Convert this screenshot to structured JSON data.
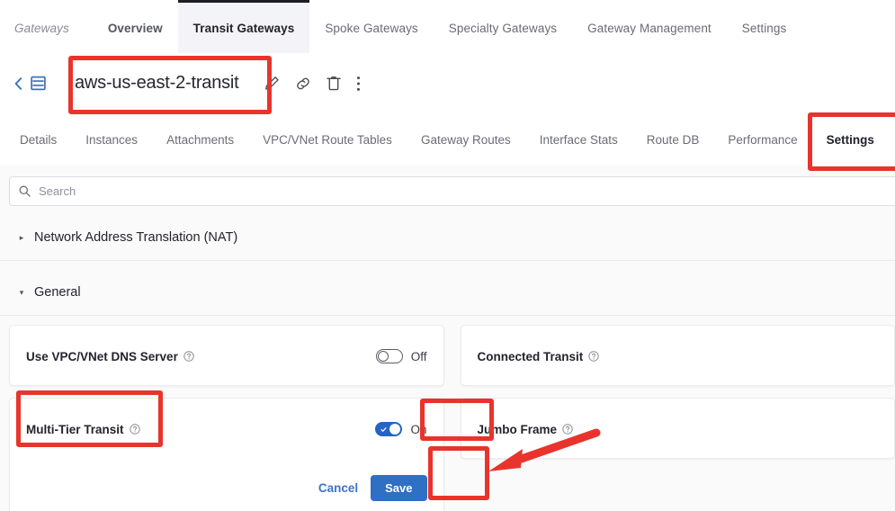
{
  "top_tabs": [
    {
      "label": "Gateways",
      "style": "crumb",
      "active": false
    },
    {
      "label": "Overview",
      "style": "strong",
      "active": false
    },
    {
      "label": "Transit Gateways",
      "style": "normal",
      "active": true
    },
    {
      "label": "Spoke Gateways",
      "style": "normal",
      "active": false
    },
    {
      "label": "Specialty Gateways",
      "style": "normal",
      "active": false
    },
    {
      "label": "Gateway Management",
      "style": "normal",
      "active": false
    },
    {
      "label": "Settings",
      "style": "normal",
      "active": false
    }
  ],
  "title_bar": {
    "gateway_name": "aws-us-east-2-transit",
    "back_icon": "chevron-left-icon",
    "list_icon": "list-view-icon",
    "actions": [
      {
        "name": "edit-icon",
        "label": "Edit"
      },
      {
        "name": "link-icon",
        "label": "Copy link"
      },
      {
        "name": "trash-icon",
        "label": "Delete"
      },
      {
        "name": "more-icon",
        "label": "More"
      }
    ]
  },
  "sub_tabs": [
    {
      "label": "Details",
      "active": false
    },
    {
      "label": "Instances",
      "active": false
    },
    {
      "label": "Attachments",
      "active": false
    },
    {
      "label": "VPC/VNet Route Tables",
      "active": false
    },
    {
      "label": "Gateway Routes",
      "active": false
    },
    {
      "label": "Interface Stats",
      "active": false
    },
    {
      "label": "Route DB",
      "active": false
    },
    {
      "label": "Performance",
      "active": false
    },
    {
      "label": "Settings",
      "active": true
    }
  ],
  "search": {
    "placeholder": "Search",
    "value": "",
    "icon": "search-icon"
  },
  "sections": [
    {
      "name": "Network Address Translation (NAT)",
      "expanded": false,
      "caret": "▸"
    },
    {
      "name": "General",
      "expanded": true,
      "caret": "▾"
    }
  ],
  "settings_cards": [
    {
      "label": "Use VPC/VNet DNS Server",
      "toggle_state": "Off",
      "toggle_on": false,
      "help_icon": "help-circle-icon",
      "highlighted": false
    },
    {
      "label": "Connected Transit",
      "toggle_state": "",
      "toggle_on": false,
      "help_icon": "help-circle-icon",
      "highlighted": false
    },
    {
      "label": "Multi-Tier Transit",
      "toggle_state": "On",
      "toggle_on": true,
      "help_icon": "help-circle-icon",
      "highlighted": true
    },
    {
      "label": "Jumbo Frame",
      "toggle_state": "",
      "toggle_on": false,
      "help_icon": "help-circle-icon",
      "highlighted": false
    }
  ],
  "form_actions": {
    "cancel_label": "Cancel",
    "save_label": "Save"
  },
  "annotations": {
    "accent_color": "#e8342c",
    "boxes": [
      {
        "name": "gateway-name-highlight",
        "target": "aws-us-east-2-transit"
      },
      {
        "name": "settings-tab-highlight",
        "target": "Settings"
      },
      {
        "name": "multi-tier-transit-label-highlight",
        "target": "Multi-Tier Transit"
      },
      {
        "name": "multi-tier-toggle-highlight",
        "target": "On"
      },
      {
        "name": "save-button-highlight",
        "target": "Save"
      }
    ],
    "arrow": {
      "name": "save-button-arrow",
      "points_to": "Save"
    }
  },
  "colors": {
    "primary_blue": "#2f6fc4",
    "toggle_on_blue": "#2563c9",
    "annotation_red": "#e8342c",
    "link_blue": "#3b74c4"
  }
}
